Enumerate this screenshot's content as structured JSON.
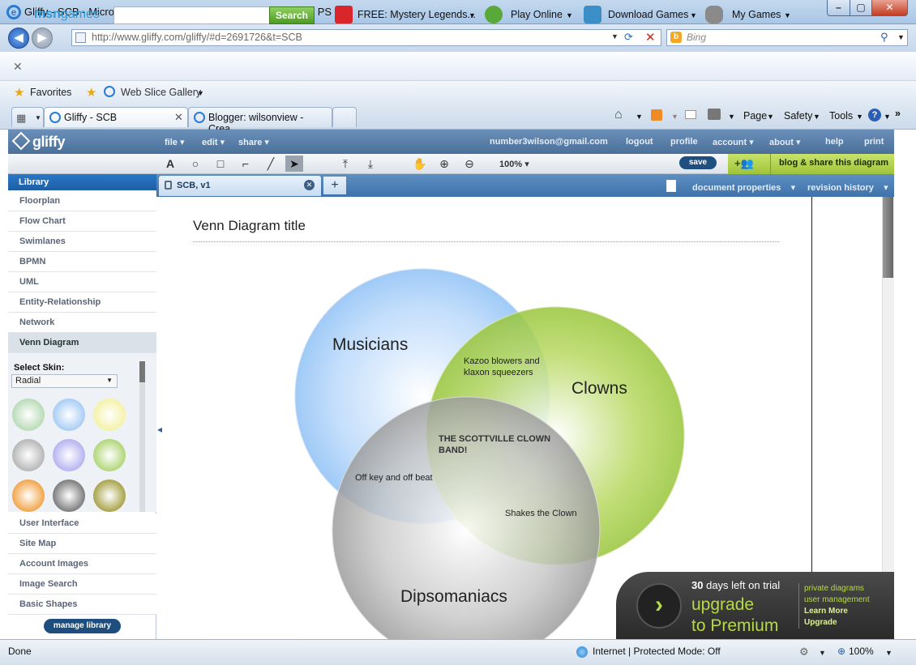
{
  "window": {
    "title": "Gliffy - SCB - Microsoft Internet Explorer provided by Rockford PS"
  },
  "address": {
    "url": "http://www.gliffy.com/gliffy/#d=2691726&t=SCB",
    "search_placeholder": "Bing"
  },
  "msn": {
    "logo_a": "msn",
    "logo_b": "games",
    "search_label": "Search",
    "items": [
      "FREE: Mystery Legends...",
      "Play Online",
      "Download Games",
      "My Games"
    ]
  },
  "favorites": {
    "label": "Favorites",
    "web_slice": "Web Slice Gallery"
  },
  "browser_tabs": [
    {
      "label": "Gliffy - SCB"
    },
    {
      "label": "Blogger: wilsonview - Crea..."
    }
  ],
  "browser_tools": {
    "page": "Page",
    "safety": "Safety",
    "tools": "Tools"
  },
  "gliffy": {
    "logo": "gliffy",
    "menus": [
      "file",
      "edit",
      "share"
    ],
    "email": "number3wilson@gmail.com",
    "right_links": [
      "logout",
      "profile",
      "account",
      "about",
      "help",
      "print"
    ],
    "zoom": "100%",
    "save": "save",
    "share_label": "blog & share this diagram",
    "doc_tab": "SCB, v1",
    "doc_properties": "document properties",
    "revision_history": "revision history"
  },
  "library": {
    "header": "Library",
    "items": [
      "Floorplan",
      "Flow Chart",
      "Swimlanes",
      "BPMN",
      "UML",
      "Entity-Relationship",
      "Network",
      "Venn Diagram"
    ],
    "select_skin_label": "Select Skin:",
    "skin_value": "Radial",
    "more_items": [
      "User Interface",
      "Site Map",
      "Account Images",
      "Image Search",
      "Basic Shapes"
    ],
    "manage": "manage library",
    "skin_colors": [
      "#b9dcb7",
      "#a9cdf5",
      "#f4f2a8",
      "#b7b7b7",
      "#b7b3f1",
      "#b2d67a",
      "#f2a64c",
      "#7d7d7d",
      "#a8a44a"
    ]
  },
  "diagram": {
    "title": "Venn Diagram title",
    "musicians": "Musicians",
    "clowns": "Clowns",
    "dipsomaniacs": "Dipsomaniacs",
    "kazoo_line1": "Kazoo blowers and",
    "kazoo_line2": "klaxon squeezers",
    "center_line1": "THE SCOTTVILLE CLOWN",
    "center_line2": "BAND!",
    "off_key": "Off key and off beat",
    "shakes": "Shakes the Clown"
  },
  "promo": {
    "days": "30",
    "days_text": "days left on trial",
    "upgrade": "upgrade",
    "to_premium": "to Premium",
    "links": [
      "private diagrams",
      "user management",
      "Learn More",
      "Upgrade"
    ]
  },
  "status": {
    "left": "Done",
    "zone": "Internet | Protected Mode: Off",
    "zoom": "100%"
  }
}
